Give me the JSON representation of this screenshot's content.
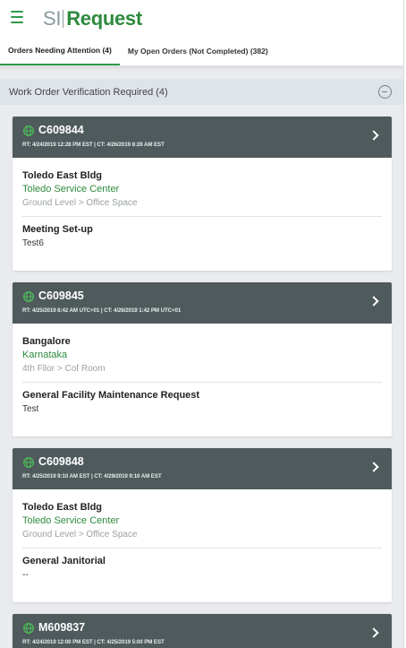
{
  "header": {
    "menu_icon": "hamburger-menu-icon",
    "logo_si": "SI",
    "logo_request": "Request",
    "accent_color": "#2e9a4a"
  },
  "tabs": [
    {
      "label": "Orders Needing Attention (4)",
      "active": true
    },
    {
      "label": "My Open Orders (Not Completed) (382)",
      "active": false
    }
  ],
  "section": {
    "title": "Work Order Verification Required (4)",
    "collapse_icon": "minus-circle-icon"
  },
  "orders": [
    {
      "number": "C609844",
      "times": "RT: 4/24/2019 12:28 PM EST | CT: 4/26/2019 8:28 AM EST",
      "building": "Toledo East Bldg",
      "site": "Toledo Service Center",
      "location": "Ground Level > Office Space",
      "request_type": "Meeting Set-up",
      "description": "Test6"
    },
    {
      "number": "C609845",
      "times": "RT: 4/25/2019 8:42 AM UTC+01 | CT: 4/26/2019 1:42 PM UTC+01",
      "building": "Bangalore",
      "site": "Karnataka",
      "location": "4th Fllor > Cof Room",
      "request_type": "General Facility Maintenance Request",
      "description": "Test"
    },
    {
      "number": "C609848",
      "times": "RT: 4/25/2019 9:10 AM EST | CT: 4/29/2019 9:10 AM EST",
      "building": "Toledo East Bldg",
      "site": "Toledo Service Center",
      "location": "Ground Level > Office Space",
      "request_type": "General Janitorial",
      "description": "--"
    },
    {
      "number": "M609837",
      "times": "RT: 4/24/2019 12:00 PM EST | CT: 4/25/2019 5:00 PM EST"
    }
  ]
}
